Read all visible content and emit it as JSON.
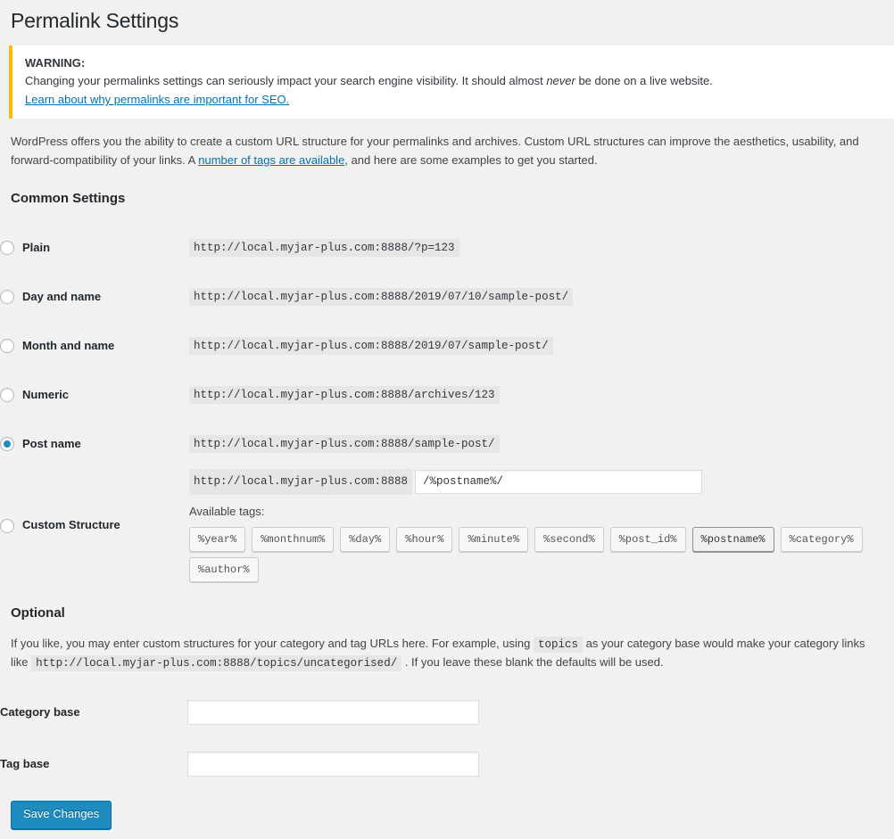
{
  "page": {
    "title": "Permalink Settings"
  },
  "notice": {
    "strong": "WARNING:",
    "body_before": "Changing your permalinks settings can seriously impact your search engine visibility. It should almost ",
    "body_em": "never",
    "body_after": " be done on a live website.",
    "link": "Learn about why permalinks are important for SEO.",
    "accent_color": "#ffb900"
  },
  "intro": {
    "part1": "WordPress offers you the ability to create a custom URL structure for your permalinks and archives. Custom URL structures can improve the aesthetics, usability, and forward-compatibility of your links. A ",
    "link": "number of tags are available",
    "part2": ", and here are some examples to get you started."
  },
  "common_settings": {
    "heading": "Common Settings",
    "options": [
      {
        "label": "Plain",
        "example": "http://local.myjar-plus.com:8888/?p=123",
        "selected": false
      },
      {
        "label": "Day and name",
        "example": "http://local.myjar-plus.com:8888/2019/07/10/sample-post/",
        "selected": false
      },
      {
        "label": "Month and name",
        "example": "http://local.myjar-plus.com:8888/2019/07/sample-post/",
        "selected": false
      },
      {
        "label": "Numeric",
        "example": "http://local.myjar-plus.com:8888/archives/123",
        "selected": false
      },
      {
        "label": "Post name",
        "example": "http://local.myjar-plus.com:8888/sample-post/",
        "selected": true
      }
    ],
    "custom": {
      "label": "Custom Structure",
      "prefix": "http://local.myjar-plus.com:8888",
      "value": "/%postname%/",
      "placeholder": "",
      "available_tags_label": "Available tags:",
      "tags": [
        {
          "name": "%year%",
          "active": false
        },
        {
          "name": "%monthnum%",
          "active": false
        },
        {
          "name": "%day%",
          "active": false
        },
        {
          "name": "%hour%",
          "active": false
        },
        {
          "name": "%minute%",
          "active": false
        },
        {
          "name": "%second%",
          "active": false
        },
        {
          "name": "%post_id%",
          "active": false
        },
        {
          "name": "%postname%",
          "active": true
        },
        {
          "name": "%category%",
          "active": false
        },
        {
          "name": "%author%",
          "active": false
        }
      ]
    }
  },
  "optional": {
    "heading": "Optional",
    "text_part1": "If you like, you may enter custom structures for your category and tag URLs here. For example, using ",
    "code1": "topics",
    "text_part2": " as your category base would make your category links like ",
    "code2": "http://local.myjar-plus.com:8888/topics/uncategorised/",
    "text_part3": " . If you leave these blank the defaults will be used.",
    "fields": [
      {
        "label": "Category base",
        "value": "",
        "placeholder": ""
      },
      {
        "label": "Tag base",
        "value": "",
        "placeholder": ""
      }
    ]
  },
  "submit": {
    "save_label": "Save Changes",
    "button_color": "#1e8cbe"
  }
}
